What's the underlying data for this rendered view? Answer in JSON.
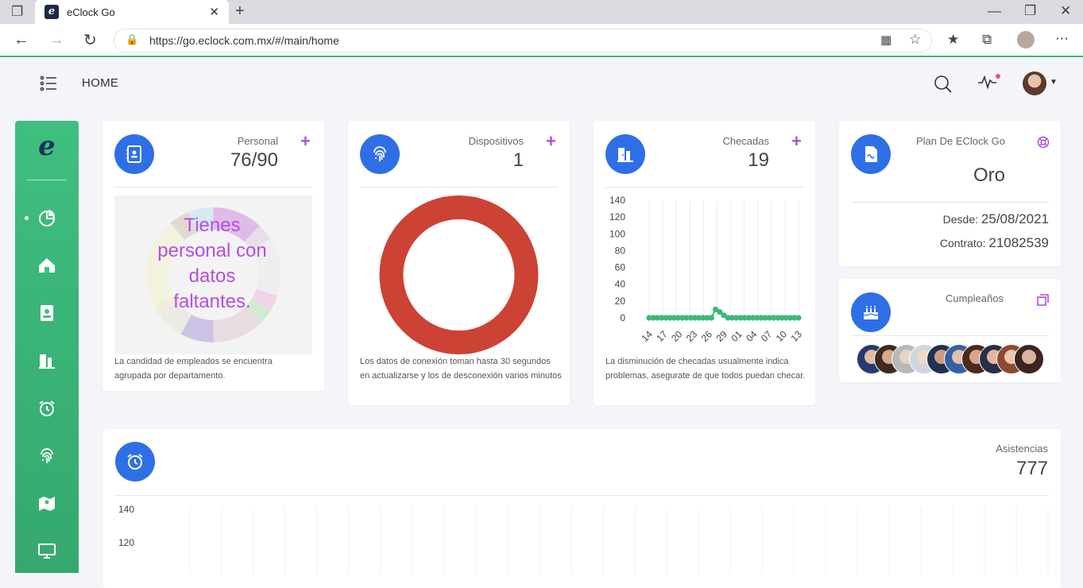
{
  "browser": {
    "tab_title": "eClock Go",
    "tab_favicon": "e",
    "url": "https://go.eclock.com.mx/#/main/home"
  },
  "header": {
    "title": "HOME"
  },
  "sidebar": {
    "logo": "e"
  },
  "cards": {
    "personal": {
      "title": "Personal",
      "value": "76/90",
      "message": "Tienes personal con datos faltantes.",
      "note": "La candidad de empleados se encuentra agrupada por departamento."
    },
    "dispositivos": {
      "title": "Dispositivos",
      "value": "1",
      "note": "Los datos de conexión toman hasta 30 segundos en actualizarse y los de desconexión varios minutos"
    },
    "checadas": {
      "title": "Checadas",
      "value": "19",
      "note": "La disminución de checadas usualmente indica problemas, asegurate de que todos puedan checar."
    },
    "plan": {
      "title": "Plan De EClock Go",
      "value": "Oro",
      "desde_label": "Desde:",
      "desde_value": "25/08/2021",
      "contrato_label": "Contrato:",
      "contrato_value": "21082539"
    },
    "cumpleanos": {
      "title": "Cumpleaños"
    },
    "asistencias": {
      "title": "Asistencias",
      "value": "777"
    }
  },
  "colors": {
    "accent": "#2f6fe6",
    "sidebar_green": "#3fbf7f",
    "plus_purple": "#a950e0",
    "donut_red": "#cc4234",
    "line_green": "#3cb878"
  },
  "chart_data": [
    {
      "type": "line",
      "yticks": [
        0,
        20,
        40,
        60,
        80,
        100,
        120,
        140
      ],
      "ylim": [
        0,
        140
      ],
      "x_labels": [
        "14",
        "17",
        "20",
        "23",
        "26",
        "29",
        "01",
        "04",
        "07",
        "10",
        "13"
      ],
      "series": [
        {
          "values": [
            0,
            0,
            0,
            0,
            0,
            0,
            0,
            0,
            0,
            0,
            0,
            0,
            0,
            0,
            0,
            0,
            10,
            7,
            3,
            0,
            0,
            0,
            0,
            0,
            0,
            0,
            0,
            0,
            0,
            0,
            0,
            0,
            0,
            0,
            0,
            0,
            0
          ]
        }
      ]
    },
    {
      "type": "pie",
      "slices": [
        {
          "value": 1
        }
      ]
    },
    {
      "type": "line",
      "yticks": [
        120,
        140
      ]
    }
  ]
}
